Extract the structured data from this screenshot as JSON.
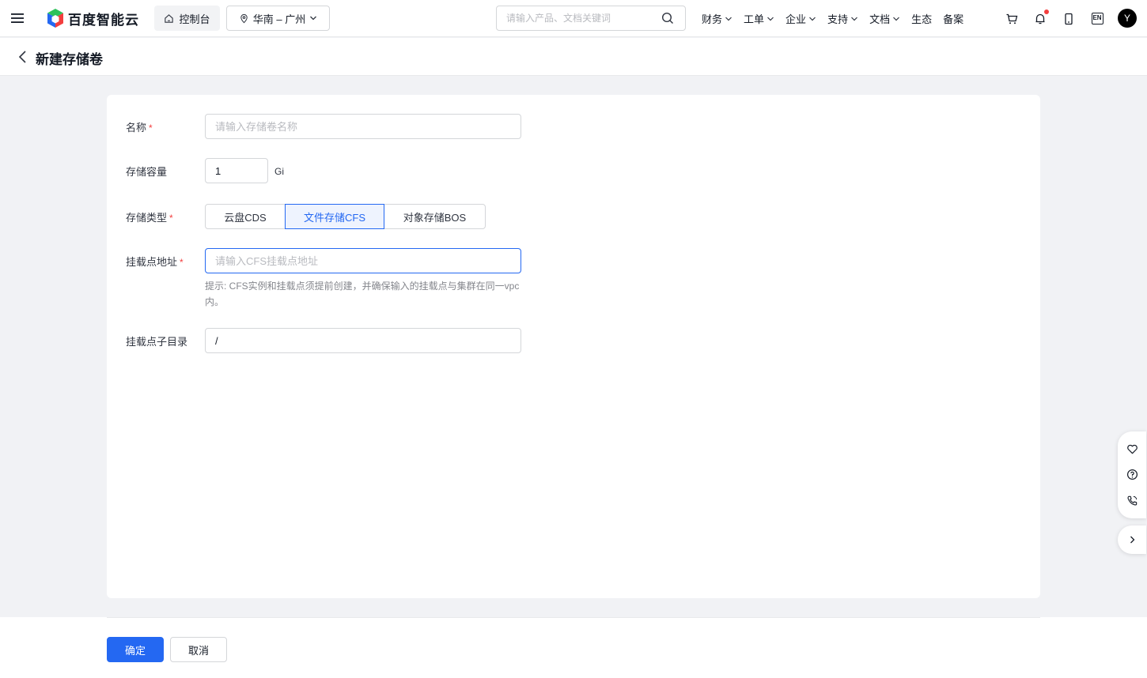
{
  "topbar": {
    "menu_icon": "hamburger-menu-icon",
    "logo_text": "百度智能云",
    "console_label": "控制台",
    "region_label": "华南 – 广州",
    "search_placeholder": "请输入产品、文档关键词",
    "nav": [
      {
        "label": "财务",
        "dropdown": true
      },
      {
        "label": "工单",
        "dropdown": true
      },
      {
        "label": "企业",
        "dropdown": true
      },
      {
        "label": "支持",
        "dropdown": true
      },
      {
        "label": "文档",
        "dropdown": true
      },
      {
        "label": "生态",
        "dropdown": false
      },
      {
        "label": "备案",
        "dropdown": false
      }
    ],
    "icons": [
      "cart-icon",
      "bell-icon",
      "mobile-icon",
      "language-en-icon"
    ],
    "language_label": "EN",
    "avatar_initial": "Y"
  },
  "page": {
    "title": "新建存储卷"
  },
  "form": {
    "name": {
      "label": "名称",
      "required": true,
      "placeholder": "请输入存储卷名称",
      "value": ""
    },
    "capacity": {
      "label": "存储容量",
      "value": "1",
      "unit": "Gi"
    },
    "storage_type": {
      "label": "存储类型",
      "required": true,
      "options": [
        "云盘CDS",
        "文件存储CFS",
        "对象存储BOS"
      ],
      "selected": "文件存储CFS"
    },
    "mount_address": {
      "label": "挂载点地址",
      "required": true,
      "placeholder": "请输入CFS挂载点地址",
      "value": "",
      "hint": "提示: CFS实例和挂载点须提前创建，并确保输入的挂载点与集群在同一vpc内。"
    },
    "mount_subdir": {
      "label": "挂载点子目录",
      "value": "/"
    }
  },
  "footer": {
    "confirm_label": "确定",
    "cancel_label": "取消"
  },
  "side_tools": [
    "favorite-heart-icon",
    "help-question-icon",
    "phone-icon"
  ],
  "colors": {
    "primary": "#2468f2",
    "required": "#f33e3e",
    "background": "#f1f2f5"
  }
}
